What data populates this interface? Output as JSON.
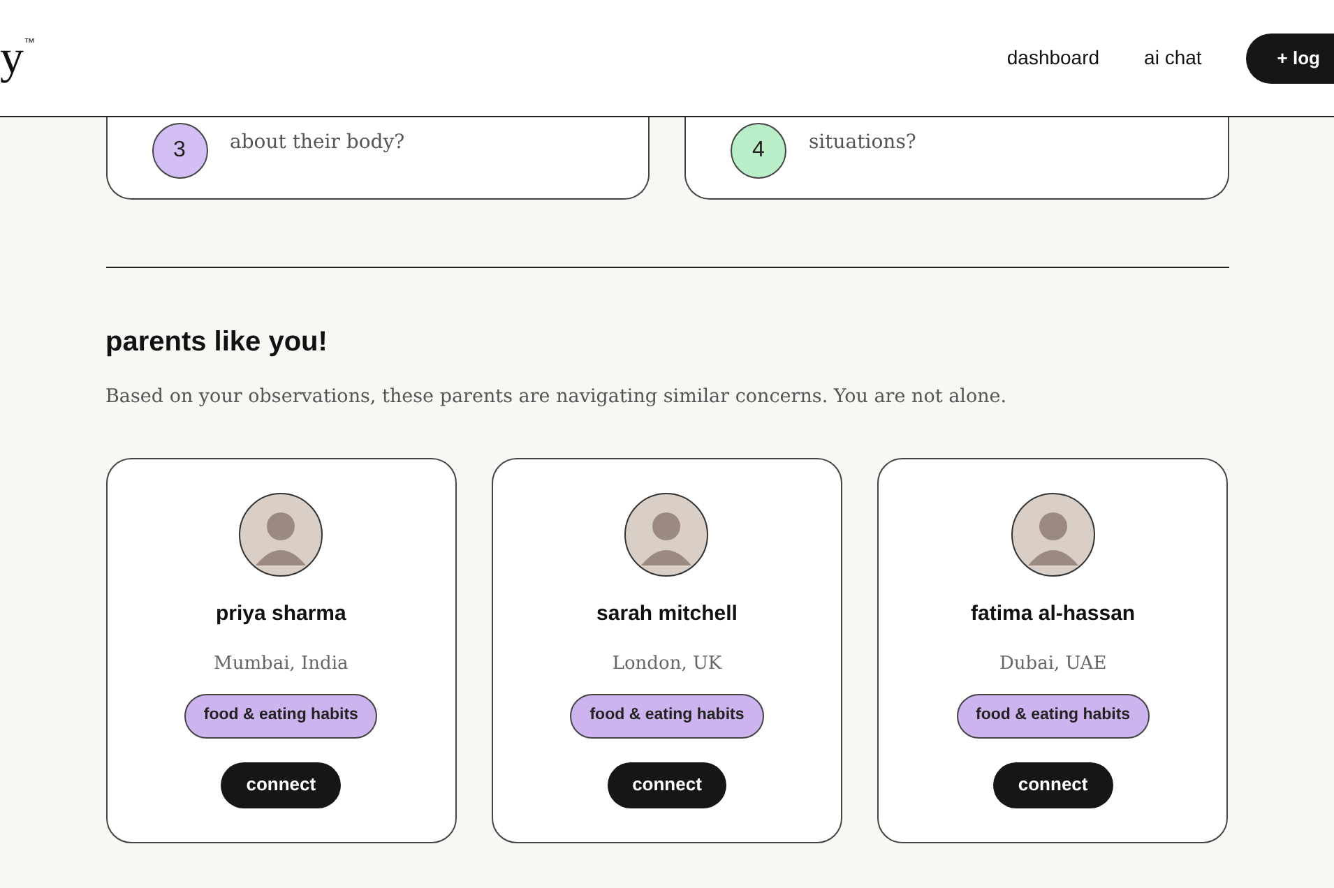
{
  "header": {
    "logo": "y",
    "logo_mark": "™",
    "nav": [
      "dashboard",
      "ai chat"
    ],
    "action_button": "+ log"
  },
  "questions": [
    {
      "number": "3",
      "text": "about their body?",
      "color": "#d4bff5"
    },
    {
      "number": "4",
      "text": "situations?",
      "color": "#b9eec8"
    }
  ],
  "section": {
    "title": "parents like you!",
    "description": "Based on your observations, these parents are navigating similar concerns. You are not alone."
  },
  "parents": [
    {
      "name": "priya sharma",
      "location": "Mumbai, India",
      "tag": "food & eating habits",
      "button": "connect"
    },
    {
      "name": "sarah mitchell",
      "location": "London, UK",
      "tag": "food & eating habits",
      "button": "connect"
    },
    {
      "name": "fatima al-hassan",
      "location": "Dubai, UAE",
      "tag": "food & eating habits",
      "button": "connect"
    }
  ]
}
